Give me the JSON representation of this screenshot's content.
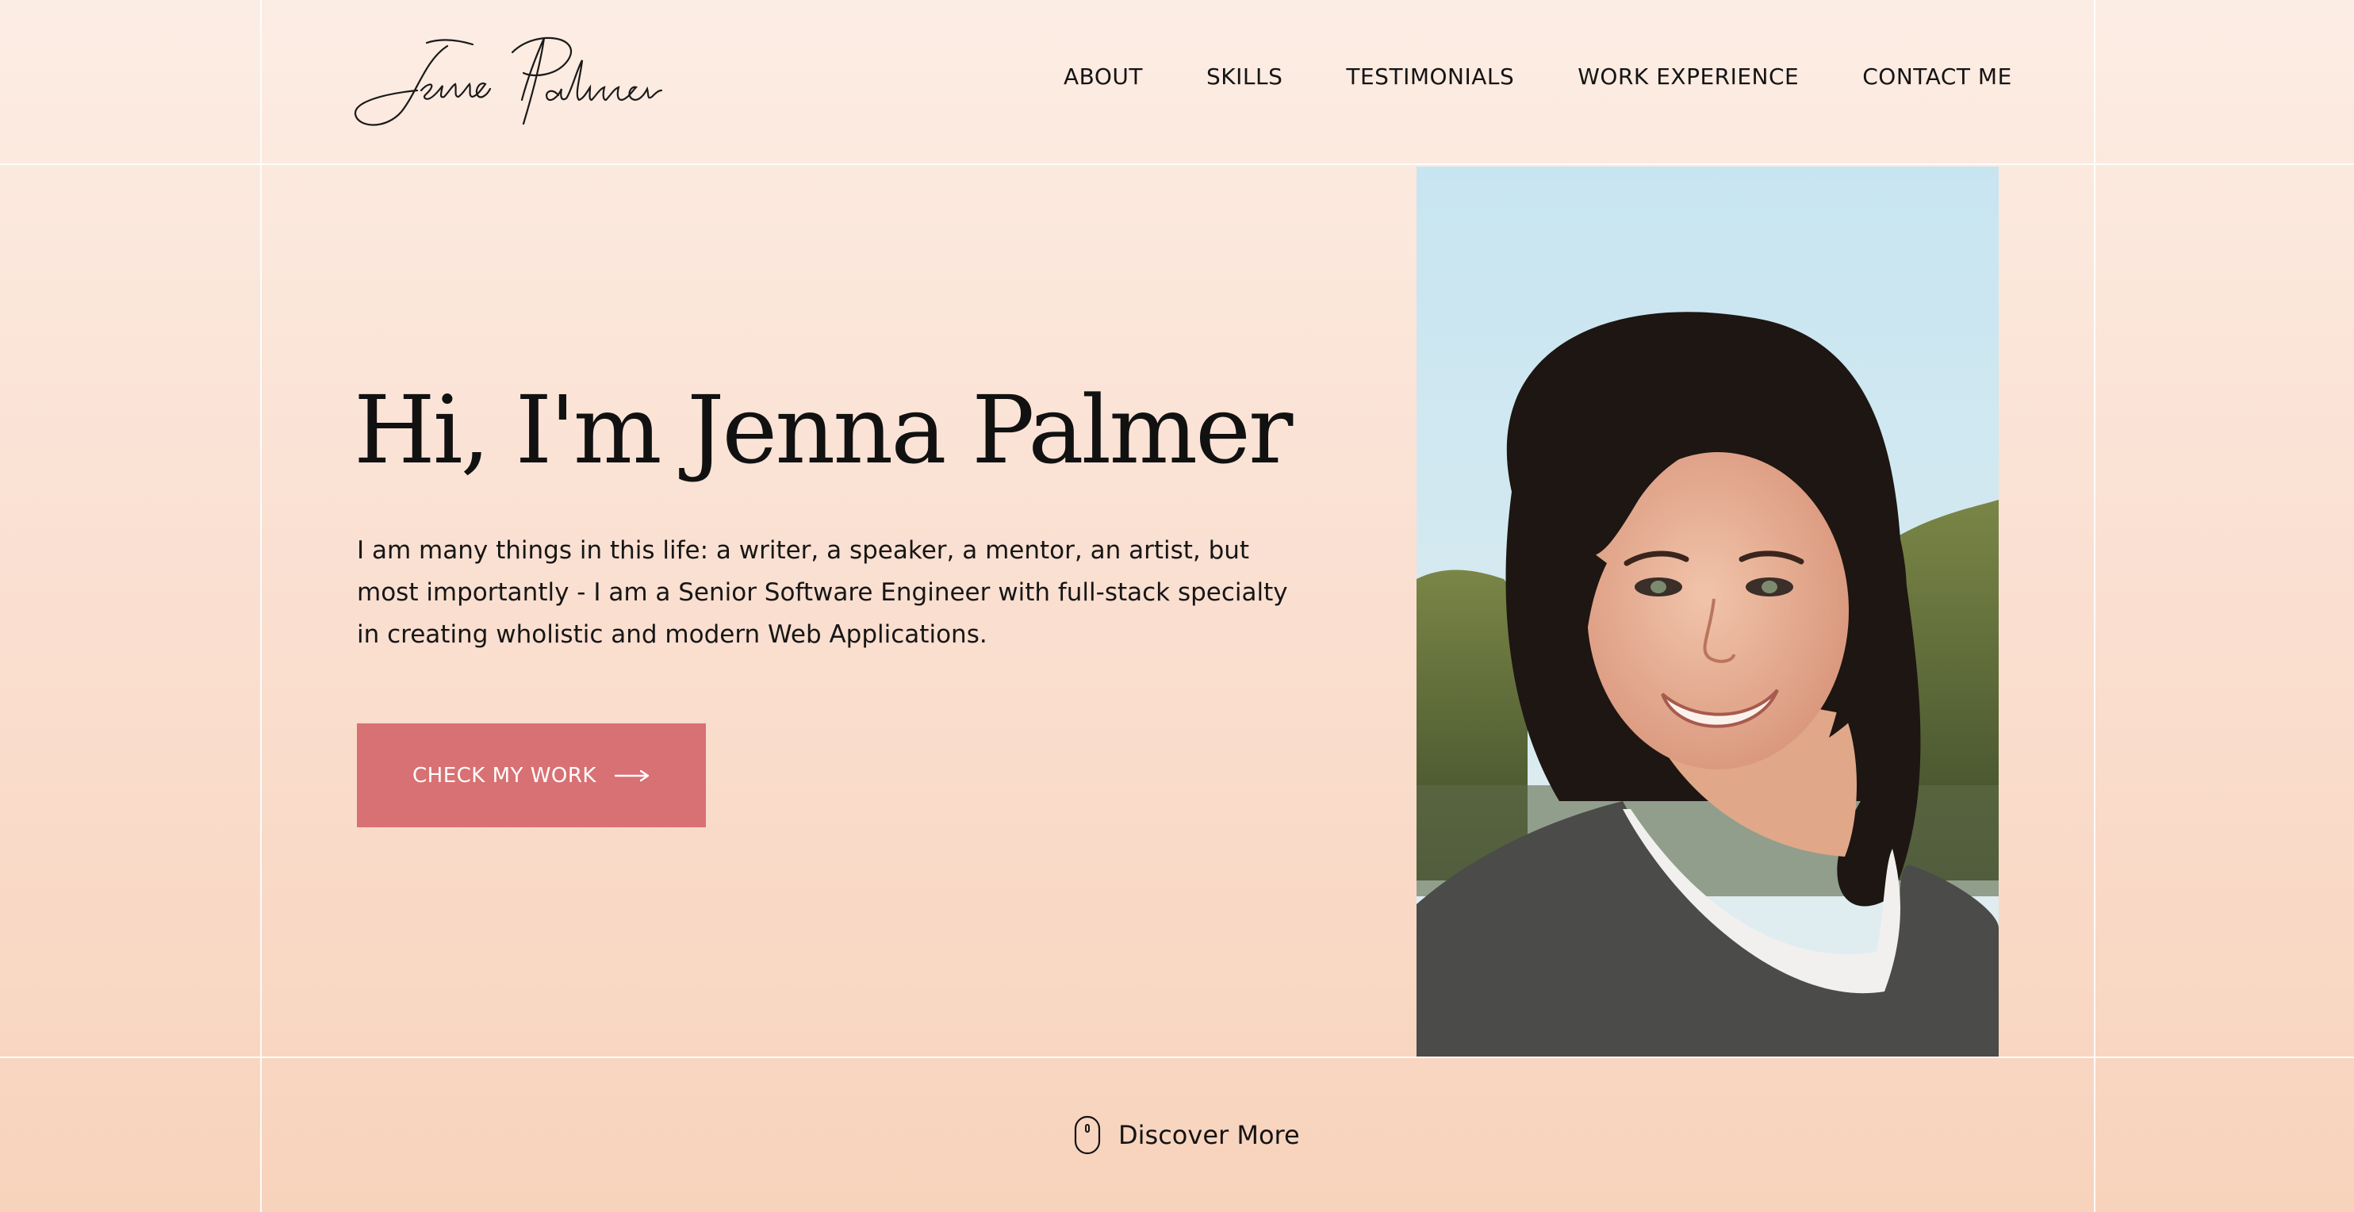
{
  "logo": {
    "text": "Jenna Palmer"
  },
  "nav": {
    "items": [
      {
        "label": "ABOUT"
      },
      {
        "label": "SKILLS"
      },
      {
        "label": "TESTIMONIALS"
      },
      {
        "label": "WORK EXPERIENCE"
      },
      {
        "label": "CONTACT ME"
      }
    ]
  },
  "hero": {
    "title": "Hi, I'm Jenna Palmer",
    "description": "I am many things in this life: a writer, a speaker, a mentor, an artist, but most importantly - I am a Senior Software Engineer with full-stack specialty in creating wholistic and modern Web Applications.",
    "cta_label": "CHECK MY WORK"
  },
  "discover": {
    "label": "Discover More"
  },
  "colors": {
    "accent": "#d87173",
    "background_top": "#fcede4",
    "background_bottom": "#f8d3bc",
    "text": "#141414"
  },
  "icons": {
    "cta": "arrow-right-icon",
    "discover": "mouse-icon"
  }
}
